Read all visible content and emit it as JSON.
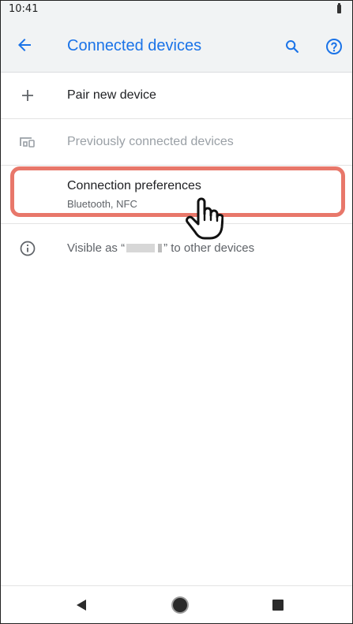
{
  "status_bar": {
    "time": "10:41",
    "battery_icon": "battery-icon"
  },
  "app_bar": {
    "title": "Connected devices",
    "back_icon": "arrow-back-icon",
    "search_icon": "search-icon",
    "help_icon": "help-icon",
    "accent_color": "#1a73e8"
  },
  "list": {
    "pair_new": {
      "icon": "plus-icon",
      "label": "Pair new device"
    },
    "previously_connected": {
      "icon": "devices-icon",
      "label": "Previously connected devices"
    },
    "connection_preferences": {
      "label": "Connection preferences",
      "summary": "Bluetooth, NFC"
    },
    "visible_as": {
      "icon": "info-icon",
      "prefix": "Visible as “",
      "suffix": "” to other devices"
    }
  },
  "highlight_color": "#e8776a",
  "nav_bar": {
    "back_icon": "nav-back-icon",
    "home_icon": "nav-home-icon",
    "recents_icon": "nav-recents-icon"
  }
}
